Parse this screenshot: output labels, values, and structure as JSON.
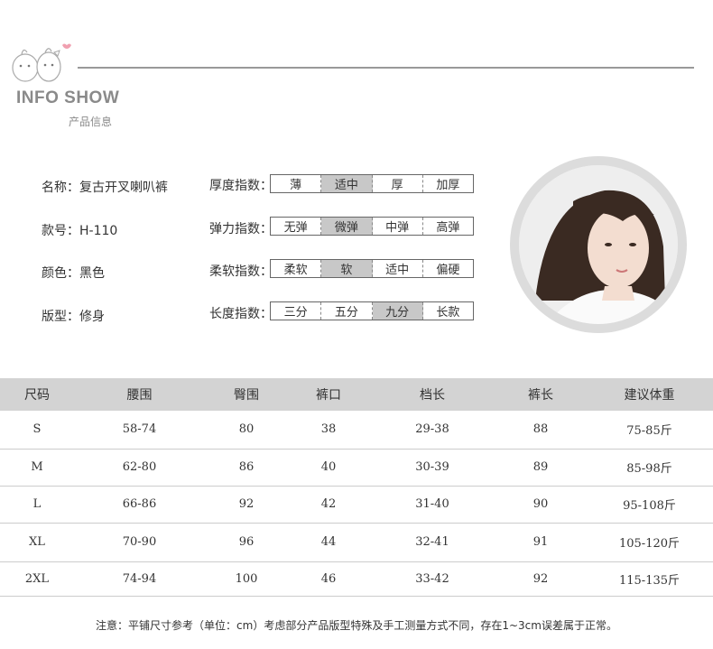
{
  "header": {
    "title": "INFO SHOW",
    "subtitle": "产品信息"
  },
  "attributes": [
    {
      "text": "名称：复古开叉喇叭裤"
    },
    {
      "text": "款号：H-110"
    },
    {
      "text": "颜色：黑色"
    },
    {
      "text": "版型：修身"
    }
  ],
  "indices": [
    {
      "label": "厚度指数：",
      "options": [
        "薄",
        "适中",
        "厚",
        "加厚"
      ],
      "selected_index": 1
    },
    {
      "label": "弹力指数：",
      "options": [
        "无弹",
        "微弹",
        "中弹",
        "高弹"
      ],
      "selected_index": 1
    },
    {
      "label": "柔软指数：",
      "options": [
        "柔软",
        "软",
        "适中",
        "偏硬"
      ],
      "selected_index": 1
    },
    {
      "label": "长度指数：",
      "options": [
        "三分",
        "五分",
        "九分",
        "长款"
      ],
      "selected_index": 2
    }
  ],
  "size_table": {
    "headers": [
      "尺码",
      "腰围",
      "臀围",
      "裤口",
      "档长",
      "裤长",
      "建议体重"
    ],
    "rows": [
      [
        "S",
        "58-74",
        "80",
        "38",
        "29-38",
        "88",
        "75-85斤"
      ],
      [
        "M",
        "62-80",
        "86",
        "40",
        "30-39",
        "89",
        "85-98斤"
      ],
      [
        "L",
        "66-86",
        "92",
        "42",
        "31-40",
        "90",
        "95-108斤"
      ],
      [
        "XL",
        "70-90",
        "96",
        "44",
        "32-41",
        "91",
        "105-120斤"
      ],
      [
        "2XL",
        "74-94",
        "100",
        "46",
        "33-42",
        "92",
        "115-135斤"
      ]
    ]
  },
  "note": "注意：平铺尺寸参考（单位：cm）考虑部分产品版型特殊及手工测量方式不同，存在1~3cm误差属于正常。",
  "colors": {
    "header_gray": "#8a8a8a",
    "table_header_bg": "#d3d3d3",
    "selected_cell": "#c8c8c8"
  }
}
